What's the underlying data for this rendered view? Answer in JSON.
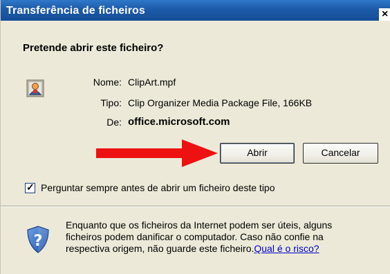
{
  "window": {
    "title": "Transferência de ficheiros",
    "close_glyph": "×"
  },
  "dialog": {
    "question": "Pretende abrir este ficheiro?",
    "file_icon": "clipart-package-icon",
    "fields": {
      "name_label": "Nome:",
      "name_value": "ClipArt.mpf",
      "type_label": "Tipo:",
      "type_value": "Clip Organizer Media Package File, 166KB",
      "from_label": "De:",
      "from_value": "office.microsoft.com"
    },
    "buttons": {
      "open_label": "Abrir",
      "cancel_label": "Cancelar"
    },
    "annotation": {
      "icon": "red-arrow-icon",
      "color": "#ee1111"
    },
    "checkbox": {
      "checked": true,
      "glyph": "✓",
      "label": "Perguntar sempre antes de abrir um ficheiro deste tipo"
    },
    "warning": {
      "icon": "shield-question-icon",
      "text": "Enquanto que os ficheiros da Internet podem ser úteis, alguns ficheiros podem danificar o computador. Caso não confie na respectiva origem, não guarde este ficheiro.",
      "link": "Qual é o risco?"
    }
  },
  "colors": {
    "titlebar": "#1c5aa8",
    "dialog_bg": "#ece9d8",
    "link": "#0000cc",
    "arrow": "#ee1111"
  }
}
